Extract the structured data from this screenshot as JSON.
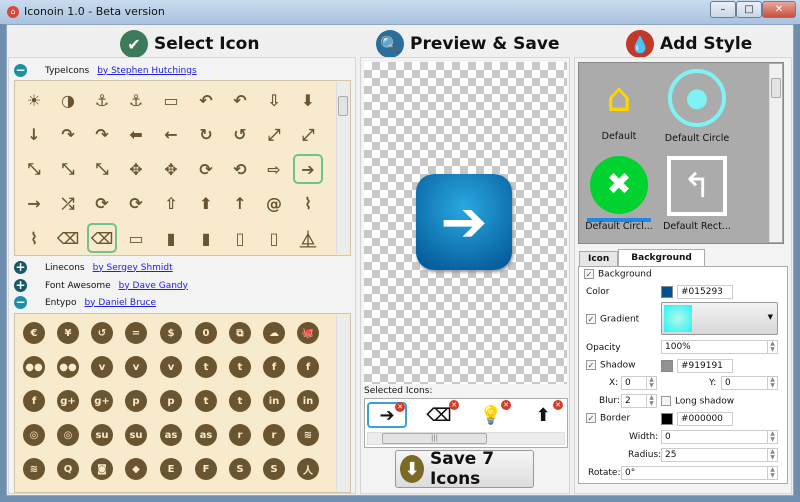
{
  "window": {
    "title": "Iconoin 1.0 - Beta version",
    "minimize": "–",
    "maximize": "□",
    "close": "✕"
  },
  "sections": {
    "select": {
      "title": "Select Icon",
      "icon": "check-circle-icon",
      "color": "#3d7a5a"
    },
    "preview": {
      "title": "Preview & Save",
      "icon": "magnifier-icon",
      "color": "#2a6f9a"
    },
    "style": {
      "title": "Add Style",
      "icon": "drop-icon",
      "color": "#c0392b"
    }
  },
  "icon_sets": [
    {
      "name": "TypeIcons",
      "author": "by Stephen Hutchings",
      "expanded": true
    },
    {
      "name": "Linecons",
      "author": "by Sergey Shmidt",
      "expanded": false
    },
    {
      "name": "Font Awesome",
      "author": "by Dave Gandy",
      "expanded": false
    },
    {
      "name": "Entypo",
      "author": "by Daniel Bruce",
      "expanded": true
    }
  ],
  "typeicons": [
    [
      [
        "sun",
        "☀"
      ],
      [
        "contrast",
        "◑"
      ],
      [
        "anchor-outline",
        "⚓"
      ],
      [
        "anchor",
        "⚓"
      ],
      [
        "archive",
        "▭"
      ],
      [
        "arrow-back-outline",
        "↶"
      ],
      [
        "arrow-back",
        "↶"
      ],
      [
        "arrow-down-outline",
        "⇩"
      ],
      [
        "arrow-down",
        "⬇"
      ]
    ],
    [
      [
        "arrow-down-small",
        "↓"
      ],
      [
        "arrow-forward-outline",
        "↷"
      ],
      [
        "arrow-forward",
        "↷"
      ],
      [
        "arrow-left-thick",
        "⬅"
      ],
      [
        "arrow-left",
        "←"
      ],
      [
        "arrow-loop-outline",
        "↻"
      ],
      [
        "arrow-loop",
        "↺"
      ],
      [
        "arrow-maximise-outline",
        "⤢"
      ],
      [
        "arrow-maximise",
        "⤢"
      ]
    ],
    [
      [
        "arrow-maximise-small",
        "⤡"
      ],
      [
        "arrow-minimise-outline",
        "⤡"
      ],
      [
        "arrow-minimise",
        "⤡"
      ],
      [
        "arrow-move-outline",
        "✥"
      ],
      [
        "arrow-move",
        "✥"
      ],
      [
        "arrow-repeat-outline",
        "⟳"
      ],
      [
        "arrow-repeat",
        "⟲"
      ],
      [
        "arrow-right-outline",
        "⇨"
      ],
      [
        "arrow-right",
        "➔",
        true
      ]
    ],
    [
      [
        "arrow-right-small",
        "→"
      ],
      [
        "arrow-shuffle",
        "⤮"
      ],
      [
        "arrow-sync-outline",
        "⟳"
      ],
      [
        "arrow-sync",
        "⟳"
      ],
      [
        "arrow-up-outline",
        "⇧"
      ],
      [
        "arrow-up",
        "⬆"
      ],
      [
        "arrow-up-small",
        "↑"
      ],
      [
        "at",
        "@"
      ],
      [
        "attachment-outline",
        "⌇"
      ]
    ],
    [
      [
        "attachment",
        "⌇"
      ],
      [
        "backspace-outline",
        "⌫"
      ],
      [
        "backspace",
        "⌫",
        true
      ],
      [
        "battery-charge",
        "▭"
      ],
      [
        "battery-full",
        "▮"
      ],
      [
        "battery-high",
        "▮"
      ],
      [
        "battery-low",
        "▯"
      ],
      [
        "battery-mid",
        "▯"
      ],
      [
        "beaker",
        "⏅"
      ]
    ]
  ],
  "entypo": [
    [
      [
        "euro",
        "€"
      ],
      [
        "yen",
        "¥"
      ],
      [
        "ccw",
        "↺"
      ],
      [
        "equal",
        "="
      ],
      [
        "no-dollar",
        "$"
      ],
      [
        "zero",
        "0"
      ],
      [
        "copy",
        "⧉"
      ],
      [
        "cloud",
        "☁"
      ],
      [
        "github",
        "🐙"
      ]
    ],
    [
      [
        "flickr",
        "●●"
      ],
      [
        "flickr-dots",
        "●●"
      ],
      [
        "vimeo-circle",
        "v"
      ],
      [
        "vimeo",
        "v"
      ],
      [
        "vimeo-square",
        "v"
      ],
      [
        "twitter",
        "t"
      ],
      [
        "twitter-circle",
        "t"
      ],
      [
        "facebook",
        "f"
      ],
      [
        "facebook-circle",
        "f"
      ]
    ],
    [
      [
        "facebook-square",
        "f"
      ],
      [
        "gplus",
        "g+"
      ],
      [
        "gplus-circle",
        "g+"
      ],
      [
        "pinterest",
        "p"
      ],
      [
        "pinterest-circle",
        "p"
      ],
      [
        "tumblr",
        "t"
      ],
      [
        "tumblr-circle",
        "t"
      ],
      [
        "linkedin",
        "in"
      ],
      [
        "linkedin-circle",
        "in"
      ]
    ],
    [
      [
        "dribbble",
        "◎"
      ],
      [
        "dribbble-circle",
        "◎"
      ],
      [
        "stumbleupon",
        "su"
      ],
      [
        "stumbleupon-circle",
        "su"
      ],
      [
        "lastfm",
        "as"
      ],
      [
        "lastfm-circle",
        "as"
      ],
      [
        "rdio",
        "r"
      ],
      [
        "rdio-circle",
        "r"
      ],
      [
        "spotify",
        "≋"
      ]
    ],
    [
      [
        "spotify-circle",
        "≋"
      ],
      [
        "qq",
        "Q"
      ],
      [
        "instagram",
        "◙"
      ],
      [
        "dropbox",
        "◆"
      ],
      [
        "evernote",
        "E"
      ],
      [
        "flattr",
        "F"
      ],
      [
        "skype",
        "S"
      ],
      [
        "skype-circle",
        "S"
      ],
      [
        "renren",
        "人"
      ]
    ]
  ],
  "preview": {
    "selected_label": "Selected Icons:",
    "bg_color": "#015293"
  },
  "selected_icons": [
    {
      "name": "arrow-right",
      "glyph": "➔"
    },
    {
      "name": "backspace",
      "glyph": "⌫"
    },
    {
      "name": "lightbulb",
      "glyph": "💡"
    },
    {
      "name": "arrow-up-circle",
      "glyph": "⬆"
    }
  ],
  "save_button": "Save 7 Icons",
  "styles": [
    {
      "label": "Default",
      "glyph": "⌂"
    },
    {
      "label": "Default Circle",
      "glyph": "💬"
    },
    {
      "label": "Default Circl...",
      "glyph": "✖"
    },
    {
      "label": "Default Rect...",
      "glyph": "↰"
    }
  ],
  "tabs": [
    "Icon",
    "Background"
  ],
  "form": {
    "background": "Background",
    "color_label": "Color",
    "color": "#015293",
    "gradient": "Gradient",
    "opacity_label": "Opacity",
    "opacity": "100%",
    "shadow": "Shadow",
    "shadow_color": "#919191",
    "x_label": "X:",
    "x": "0",
    "y_label": "Y:",
    "y": "0",
    "blur_label": "Blur:",
    "blur": "2",
    "long_shadow": "Long shadow",
    "border": "Border",
    "border_color": "#000000",
    "width_label": "Width:",
    "width": "0",
    "radius_label": "Radius:",
    "radius": "25",
    "rotate_label": "Rotate:",
    "rotate": "0°"
  }
}
